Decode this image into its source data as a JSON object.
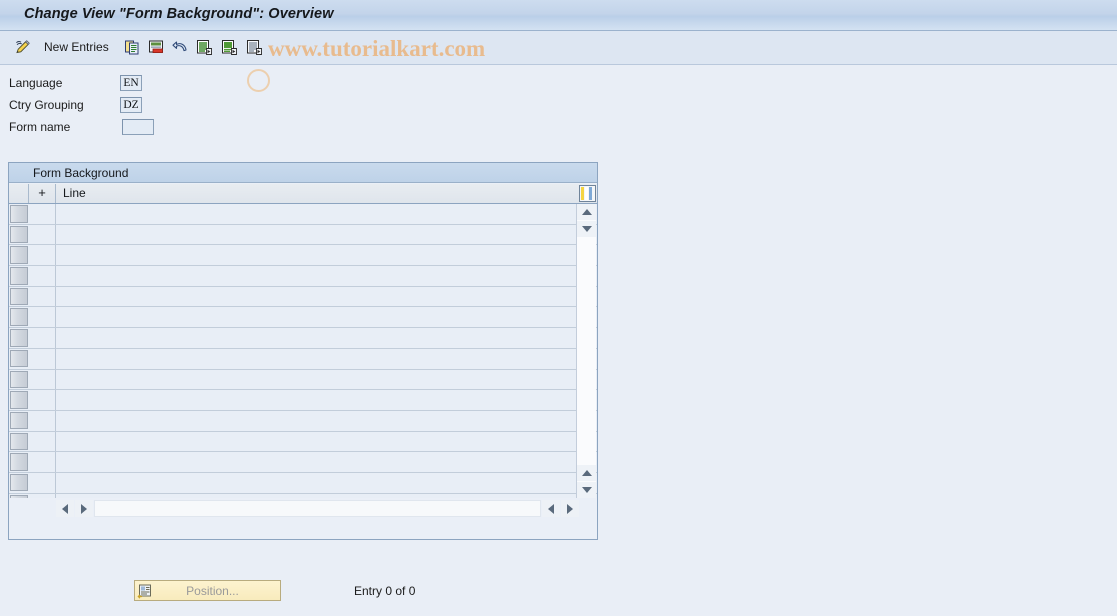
{
  "window": {
    "title": "Change View \"Form Background\": Overview"
  },
  "toolbar": {
    "edit_icon": "pencil-icon",
    "new_entries_label": "New Entries",
    "icons": [
      {
        "name": "copy-icon"
      },
      {
        "name": "delete-icon"
      },
      {
        "name": "undo-icon"
      },
      {
        "name": "select-all-icon"
      },
      {
        "name": "deselect-all-icon"
      },
      {
        "name": "details-icon"
      }
    ],
    "watermark": "www.tutorialkart.com"
  },
  "fields": [
    {
      "label": "Language",
      "value": "EN",
      "placeholder": "",
      "size": "small"
    },
    {
      "label": "Ctry Grouping",
      "value": "DZ",
      "placeholder": "",
      "size": "small"
    },
    {
      "label": "Form name",
      "value": "",
      "placeholder": "",
      "size": "wide"
    }
  ],
  "table": {
    "panel_title": "Form Background",
    "columns": {
      "select": "",
      "plus": "+",
      "line": "Line"
    },
    "config_icon": "table-settings-icon",
    "row_count": 15,
    "rows": []
  },
  "scrollbars": {
    "vertical": {
      "up": "scroll-up-icon",
      "down": "scroll-down-icon"
    },
    "horizontal": {
      "left": "scroll-left-icon",
      "right": "scroll-right-icon"
    }
  },
  "footer": {
    "position_button_label": "Position...",
    "position_button_icon": "position-icon",
    "entry_count": "Entry 0 of 0"
  },
  "colors": {
    "page_background": "#e9eef6",
    "title_bar": "#c3d4ea",
    "toolbar": "#dde6f2",
    "panel_border": "#8ca4c0",
    "watermark": "#e8bb8e",
    "button_yellow": "#f8ebbd"
  }
}
